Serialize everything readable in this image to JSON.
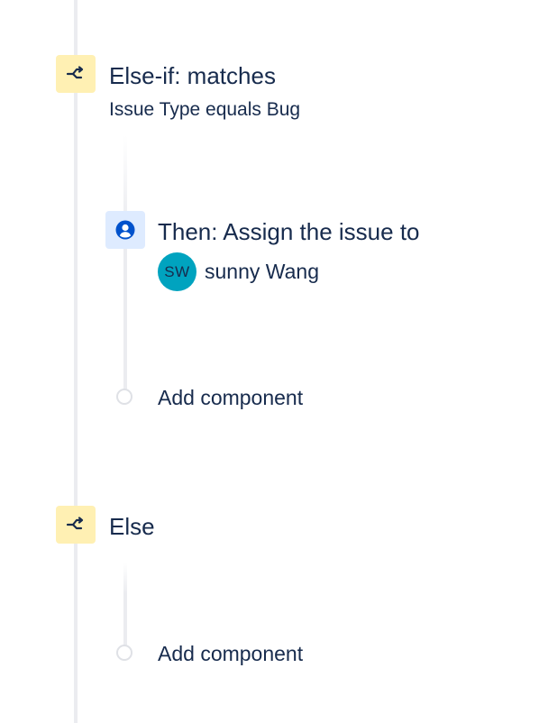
{
  "colors": {
    "text": "#172b4d",
    "branch_icon_bg": "#fff0b3",
    "action_icon_bg": "#deebff",
    "action_icon_fg": "#0052cc",
    "avatar_bg": "#00a3bf",
    "rail": "#ebecf0"
  },
  "else_if_block": {
    "icon": "branch-icon",
    "title": "Else-if: matches",
    "condition": "Issue Type equals Bug"
  },
  "then_action": {
    "icon": "assign-user-icon",
    "title": "Then: Assign the issue to",
    "assignee_initials": "SW",
    "assignee_name": "sunny Wang"
  },
  "add_component_1": {
    "label": "Add component"
  },
  "else_block": {
    "icon": "branch-icon",
    "title": "Else"
  },
  "add_component_2": {
    "label": "Add component"
  }
}
